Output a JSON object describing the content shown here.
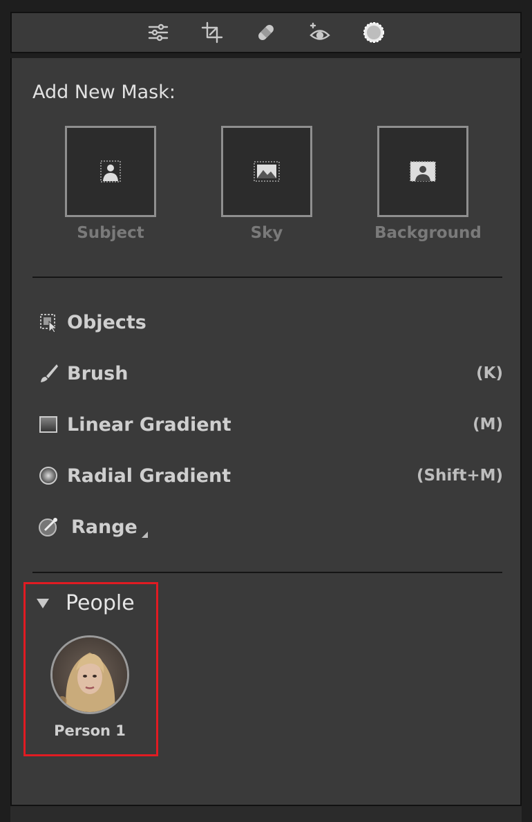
{
  "toolbar": {
    "icons": [
      "edit-sliders-icon",
      "crop-icon",
      "healing-bandage-icon",
      "red-eye-icon",
      "masking-icon"
    ]
  },
  "add_mask": {
    "title": "Add New Mask:",
    "tiles": [
      {
        "label": "Subject",
        "icon": "subject-icon"
      },
      {
        "label": "Sky",
        "icon": "sky-icon"
      },
      {
        "label": "Background",
        "icon": "background-icon"
      }
    ]
  },
  "tools": [
    {
      "label": "Objects",
      "shortcut": "",
      "icon": "objects-icon"
    },
    {
      "label": "Brush",
      "shortcut": "(K)",
      "icon": "brush-icon"
    },
    {
      "label": "Linear Gradient",
      "shortcut": "(M)",
      "icon": "linear-gradient-icon"
    },
    {
      "label": "Radial Gradient",
      "shortcut": "(Shift+M)",
      "icon": "radial-gradient-icon"
    },
    {
      "label": "Range",
      "shortcut": "",
      "icon": "range-icon"
    }
  ],
  "people": {
    "title": "People",
    "persons": [
      {
        "name": "Person 1"
      }
    ]
  },
  "colors": {
    "panel": "#3a3a3a",
    "highlight": "#e11b22"
  }
}
